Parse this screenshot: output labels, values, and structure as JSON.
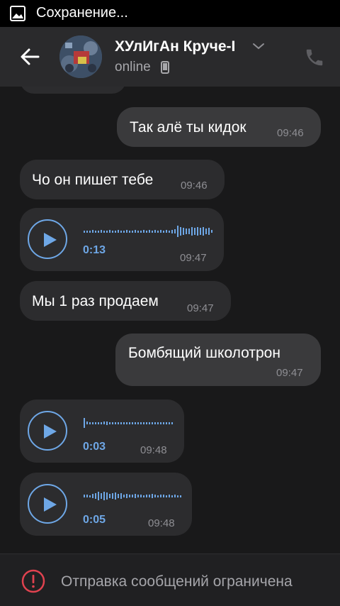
{
  "status_bar": {
    "notification_icon": "image-icon",
    "text": "Сохранение..."
  },
  "header": {
    "back_icon": "arrow-left-icon",
    "avatar": "avatar",
    "title": "ХУлИгАн Круче-І",
    "title_chevron": "chevron-down-icon",
    "status": "online",
    "device_icon": "mobile-phone-icon",
    "call_icon": "phone-icon"
  },
  "messages": [
    {
      "direction": "outgoing",
      "text": "Так алё ты кидок",
      "time": "09:46"
    },
    {
      "direction": "incoming",
      "text": "Чо он пишет тебе",
      "time": "09:46"
    },
    {
      "direction": "incoming",
      "type": "voice",
      "duration": "0:13",
      "time": "09:47"
    },
    {
      "direction": "incoming",
      "text": "Мы 1 раз продаем",
      "time": "09:47"
    },
    {
      "direction": "outgoing",
      "text": "Бомбящий школотрон",
      "time": "09:47"
    },
    {
      "direction": "incoming",
      "type": "voice",
      "duration": "0:03",
      "time": "09:48"
    },
    {
      "direction": "incoming",
      "type": "voice",
      "duration": "0:05",
      "time": "09:48"
    }
  ],
  "footer": {
    "warning_icon": "exclamation-circle-icon",
    "text": "Отправка сообщений ограничена"
  },
  "colors": {
    "background": "#19191a",
    "header": "#2a2a2c",
    "incoming_bubble": "#2c2c2e",
    "outgoing_bubble": "#3a3a3c",
    "accent": "#6ea7e6",
    "warning": "#e0424f"
  }
}
